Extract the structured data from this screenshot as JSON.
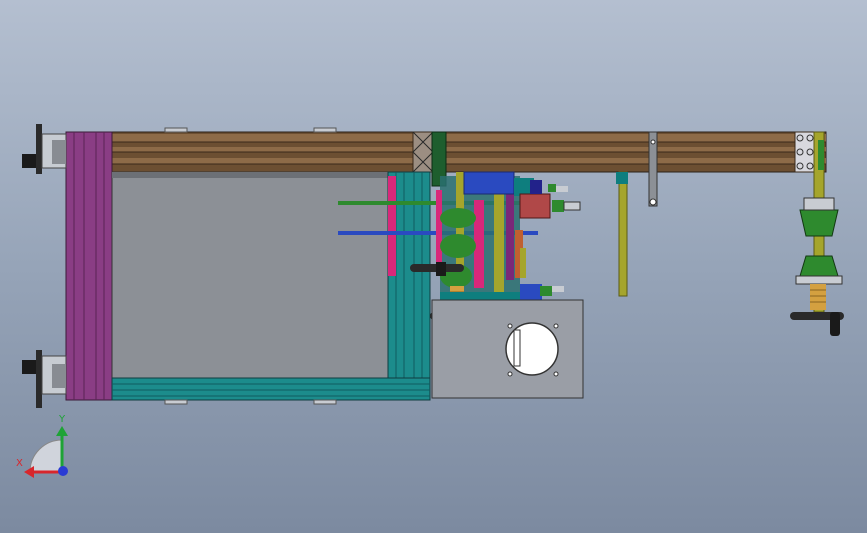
{
  "viewport": {
    "background_top": "#b4bfd0",
    "background_mid": "#96a4b8",
    "background_bottom": "#7c8aa0"
  },
  "triad": {
    "x_label": "X",
    "y_label": "Y",
    "x_color": "#d8262c",
    "y_color": "#1ea336",
    "z_color": "#2a3bd4"
  },
  "colors": {
    "rail_brown": "#6c4f32",
    "rail_light": "#8d6b48",
    "panel_gray": "#8c9096",
    "panel_dark": "#6c7076",
    "teal": "#1c8c8c",
    "teal_dark": "#0f5c60",
    "purple": "#8a3d84",
    "green": "#2e8a2e",
    "olive": "#a5a52c",
    "pink": "#d8287a",
    "blue": "#2a4ac0",
    "plate_gray": "#9a9ea6"
  }
}
